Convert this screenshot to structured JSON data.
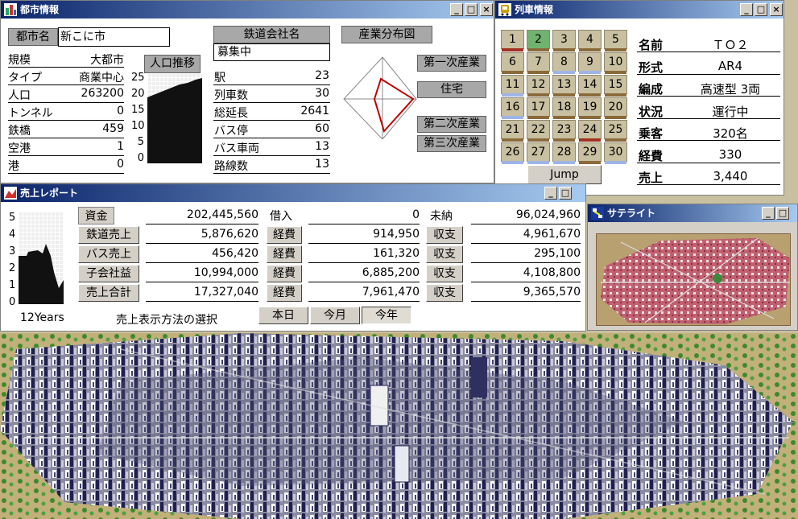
{
  "colors": {
    "titlebar": "#0a246a",
    "cell_bg": "#c8c0a0",
    "cell_active": "#6fb36f",
    "stripe_red": "#a03020",
    "stripe_blue": "#9fb4e6",
    "stripe_brown": "#8a6a3a",
    "radar_line": "#c00000"
  },
  "city_window": {
    "title": "都市情報",
    "city_name_label": "都市名",
    "city_name": "新こに市",
    "rows": [
      {
        "label": "規模",
        "value": "大都市"
      },
      {
        "label": "タイプ",
        "value": "商業中心"
      },
      {
        "label": "人口",
        "value": "263200"
      },
      {
        "label": "トンネル",
        "value": "0"
      },
      {
        "label": "鉄橋",
        "value": "459"
      },
      {
        "label": "空港",
        "value": "1"
      },
      {
        "label": "港",
        "value": "0"
      }
    ],
    "population_chart": {
      "title": "人口推移",
      "ticks": [
        "25",
        "20",
        "15",
        "10",
        "5",
        "0"
      ]
    },
    "rail_company_label": "鉄道会社名",
    "rail_company_value": "募集中",
    "stats": [
      {
        "label": "駅",
        "value": "23"
      },
      {
        "label": "列車数",
        "value": "30"
      },
      {
        "label": "総延長",
        "value": "2641"
      },
      {
        "label": "バス停",
        "value": "60"
      },
      {
        "label": "バス車両",
        "value": "13"
      },
      {
        "label": "路線数",
        "value": "13"
      }
    ],
    "industry_map_label": "産業分布図",
    "industry_labels": [
      "第一次産業",
      "住宅",
      "第二次産業",
      "第三次産業"
    ]
  },
  "train_window": {
    "title": "列車情報",
    "cells": [
      {
        "n": "1",
        "stripe": "red"
      },
      {
        "n": "2",
        "stripe": "brown",
        "active": true
      },
      {
        "n": "3",
        "stripe": "brown"
      },
      {
        "n": "4",
        "stripe": "brown"
      },
      {
        "n": "5",
        "stripe": "brown"
      },
      {
        "n": "6",
        "stripe": "brown"
      },
      {
        "n": "7",
        "stripe": "brown"
      },
      {
        "n": "8",
        "stripe": "blue"
      },
      {
        "n": "9",
        "stripe": "blue"
      },
      {
        "n": "10",
        "stripe": "brown"
      },
      {
        "n": "11",
        "stripe": "blue"
      },
      {
        "n": "12",
        "stripe": "brown"
      },
      {
        "n": "13",
        "stripe": "brown"
      },
      {
        "n": "14",
        "stripe": "brown"
      },
      {
        "n": "15",
        "stripe": "brown"
      },
      {
        "n": "16",
        "stripe": "blue"
      },
      {
        "n": "17",
        "stripe": "brown"
      },
      {
        "n": "18",
        "stripe": "brown"
      },
      {
        "n": "19",
        "stripe": "brown"
      },
      {
        "n": "20",
        "stripe": "brown"
      },
      {
        "n": "21",
        "stripe": "brown"
      },
      {
        "n": "22",
        "stripe": "brown"
      },
      {
        "n": "23",
        "stripe": "brown"
      },
      {
        "n": "24",
        "stripe": "red"
      },
      {
        "n": "25",
        "stripe": "brown"
      },
      {
        "n": "26",
        "stripe": "blue"
      },
      {
        "n": "27",
        "stripe": "blue"
      },
      {
        "n": "28",
        "stripe": "blue"
      },
      {
        "n": "29",
        "stripe": "brown"
      },
      {
        "n": "30",
        "stripe": "blue"
      }
    ],
    "jump_label": "Jump",
    "info": [
      {
        "label": "名前",
        "value": "ＴＯ２"
      },
      {
        "label": "形式",
        "value": "AR4"
      },
      {
        "label": "編成",
        "value": "高速型 3両"
      },
      {
        "label": "状況",
        "value": "運行中"
      },
      {
        "label": "乗客",
        "value": "320名"
      },
      {
        "label": "経費",
        "value": "330"
      },
      {
        "label": "売上",
        "value": "3,440"
      }
    ]
  },
  "sales_window": {
    "title": "売上レポート",
    "chart": {
      "ticks": [
        "5",
        "4",
        "3",
        "2",
        "1",
        "0"
      ],
      "label": "12Years"
    },
    "rows": [
      {
        "label": "資金",
        "value": "202,445,560",
        "label2": "借入",
        "value2": "0",
        "label3": "未納",
        "value3": "96,024,960"
      },
      {
        "label": "鉄道売上",
        "value": "5,876,620",
        "label2": "経費",
        "value2": "914,950",
        "label3": "収支",
        "value3": "4,961,670"
      },
      {
        "label": "バス売上",
        "value": "456,420",
        "label2": "経費",
        "value2": "161,320",
        "label3": "収支",
        "value3": "295,100"
      },
      {
        "label": "子会社益",
        "value": "10,994,000",
        "label2": "経費",
        "value2": "6,885,200",
        "label3": "収支",
        "value3": "4,108,800"
      },
      {
        "label": "売上合計",
        "value": "17,327,040",
        "label2": "経費",
        "value2": "7,961,470",
        "label3": "収支",
        "value3": "9,365,570"
      }
    ],
    "method_label": "売上表示方法の選択",
    "tabs": [
      "本日",
      "今月",
      "今年"
    ],
    "active_tab": "今年"
  },
  "satellite_window": {
    "title": "サテライト"
  },
  "window_buttons": {
    "minimize": "_",
    "maximize": "□",
    "close": "×"
  }
}
